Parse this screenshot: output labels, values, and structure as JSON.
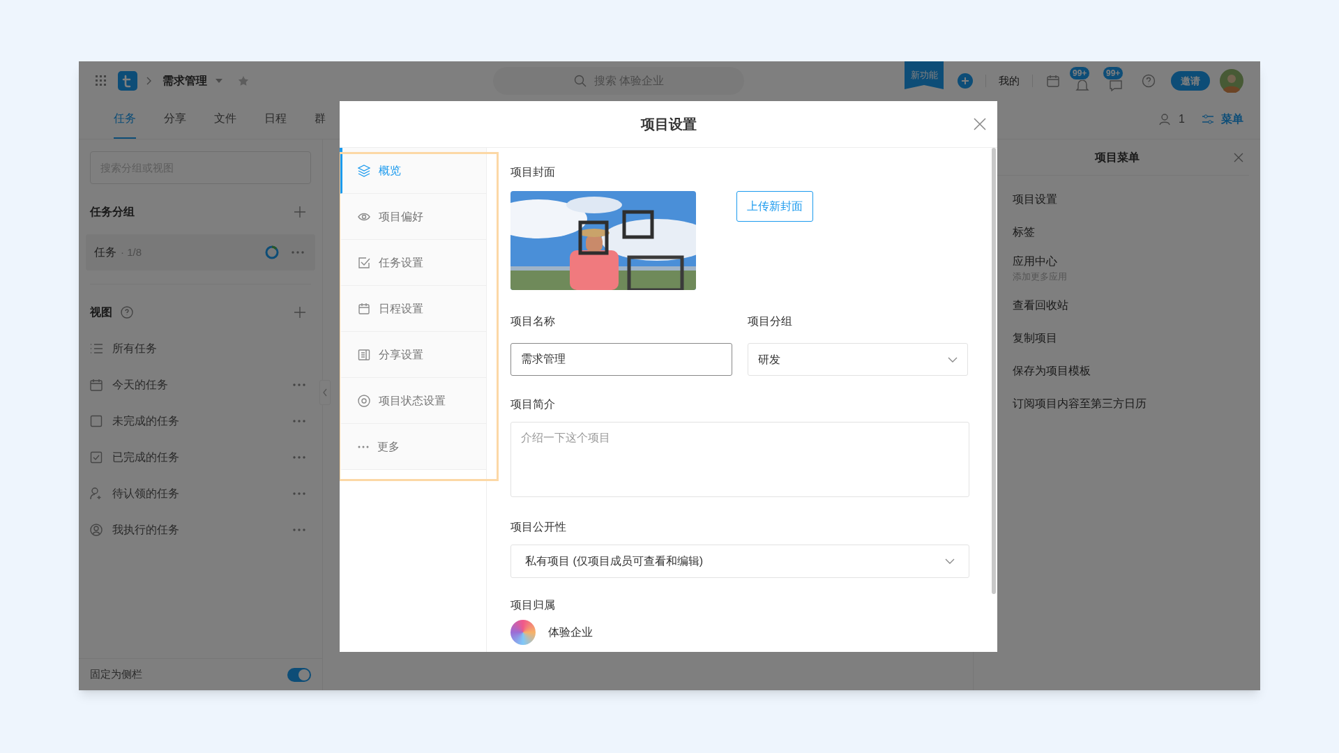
{
  "top_bar": {
    "project": "需求管理",
    "search": {
      "placeholder": "搜索 体验企业"
    },
    "new_feature": "新功能",
    "mine": "我的",
    "badges": [
      "99+",
      "99+"
    ],
    "invite": "邀请"
  },
  "nav_tabs": [
    {
      "label": "任务",
      "selected": true
    },
    {
      "label": "分享",
      "selected": false
    },
    {
      "label": "文件",
      "selected": false
    },
    {
      "label": "日程",
      "selected": false
    },
    {
      "label": "群",
      "selected": false
    }
  ],
  "nav_right": {
    "members": "1",
    "menu": "菜单"
  },
  "sidebar": {
    "search": {
      "placeholder": "搜索分组或视图"
    },
    "groups_title": "任务分组",
    "group": {
      "name": "任务",
      "count": "· 1/8"
    },
    "views_title": "视图",
    "views": [
      {
        "kind": "list",
        "label": "所有任务",
        "more": false
      },
      {
        "kind": "calendar",
        "label": "今天的任务",
        "more": true
      },
      {
        "kind": "box",
        "label": "未完成的任务",
        "more": true
      },
      {
        "kind": "checked",
        "label": "已完成的任务",
        "more": true
      },
      {
        "kind": "claim",
        "label": "待认领的任务",
        "more": true
      },
      {
        "kind": "person",
        "label": "我执行的任务",
        "more": true
      }
    ],
    "pin": {
      "label": "固定为侧栏",
      "on": true
    }
  },
  "right_panel": {
    "title": "项目菜单",
    "items": [
      {
        "label": "项目设置"
      },
      {
        "label": "标签"
      },
      {
        "label": "应用中心",
        "sub": "添加更多应用"
      },
      {
        "label": "查看回收站"
      },
      {
        "label": "复制项目"
      },
      {
        "label": "保存为项目模板"
      },
      {
        "label": "订阅项目内容至第三方日历"
      }
    ]
  },
  "dialog": {
    "title": "项目设置",
    "nav": [
      {
        "kind": "layers",
        "label": "概览",
        "selected": true
      },
      {
        "kind": "eye",
        "label": "项目偏好",
        "selected": false
      },
      {
        "kind": "check",
        "label": "任务设置",
        "selected": false
      },
      {
        "kind": "calendar",
        "label": "日程设置",
        "selected": false
      },
      {
        "kind": "share",
        "label": "分享设置",
        "selected": false
      },
      {
        "kind": "status",
        "label": "项目状态设置",
        "selected": false
      },
      {
        "kind": "more",
        "label": "更多",
        "selected": false
      }
    ],
    "cover": {
      "label": "项目封面",
      "upload": "上传新封面"
    },
    "name": {
      "label": "项目名称",
      "value": "需求管理"
    },
    "group": {
      "label": "项目分组",
      "value": "研发"
    },
    "intro": {
      "label": "项目简介",
      "placeholder": "介绍一下这个项目"
    },
    "visibility": {
      "label": "项目公开性",
      "value": "私有项目 (仅项目成员可查看和编辑)"
    },
    "owner": {
      "label": "项目归属",
      "name": "体验企业"
    }
  }
}
